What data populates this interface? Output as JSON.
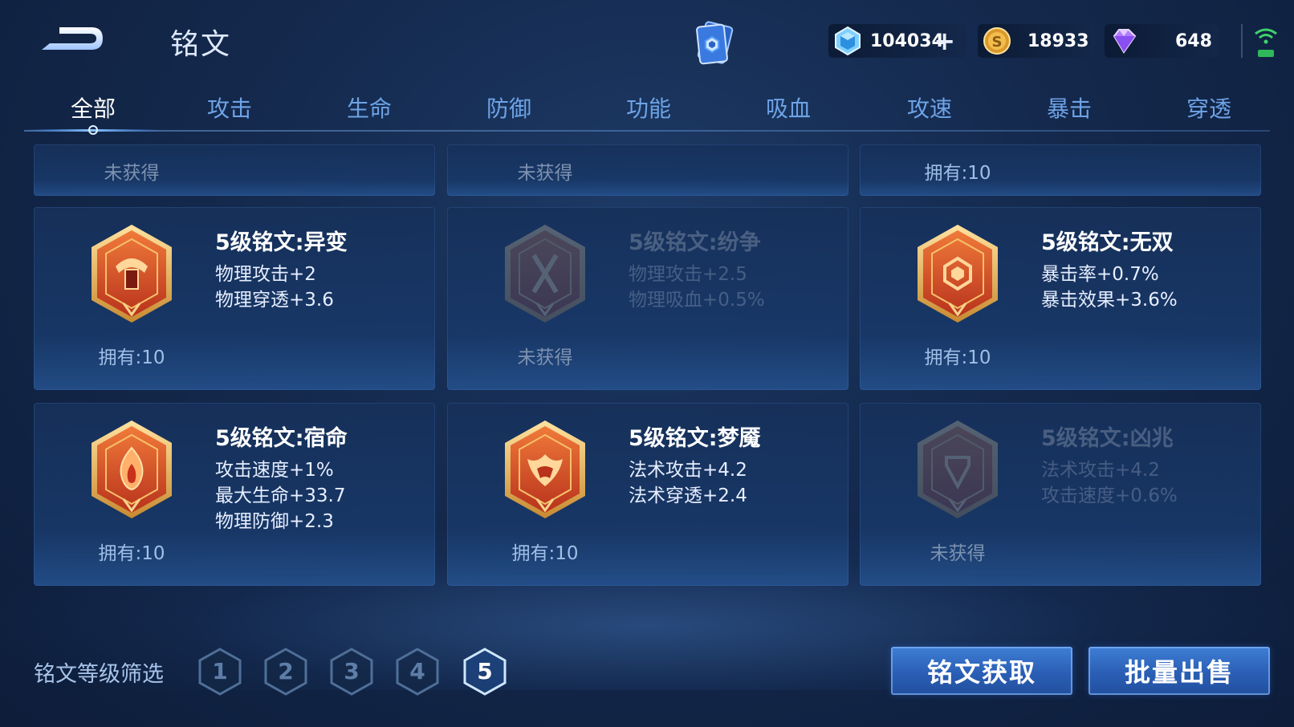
{
  "header": {
    "title": "铭文",
    "currencies": {
      "gem": "104034",
      "gold": "18933",
      "diamond": "648"
    }
  },
  "tabs": [
    "全部",
    "攻击",
    "生命",
    "防御",
    "功能",
    "吸血",
    "攻速",
    "暴击",
    "穿透"
  ],
  "active_tab": "全部",
  "top_row": [
    {
      "own": "未获得",
      "owned": false
    },
    {
      "own": "未获得",
      "owned": false
    },
    {
      "own": "拥有:10",
      "owned": true
    }
  ],
  "runes": [
    {
      "name": "5级铭文:异变",
      "stats": [
        "物理攻击+2",
        "物理穿透+3.6"
      ],
      "own": "拥有:10",
      "owned": true,
      "icon": "rune-yibian-icon"
    },
    {
      "name": "5级铭文:纷争",
      "stats": [
        "物理攻击+2.5",
        "物理吸血+0.5%"
      ],
      "own": "未获得",
      "owned": false,
      "icon": "rune-fenzheng-icon"
    },
    {
      "name": "5级铭文:无双",
      "stats": [
        "暴击率+0.7%",
        "暴击效果+3.6%"
      ],
      "own": "拥有:10",
      "owned": true,
      "icon": "rune-wushuang-icon"
    },
    {
      "name": "5级铭文:宿命",
      "stats": [
        "攻击速度+1%",
        "最大生命+33.7",
        "物理防御+2.3"
      ],
      "own": "拥有:10",
      "owned": true,
      "icon": "rune-suming-icon"
    },
    {
      "name": "5级铭文:梦魇",
      "stats": [
        "法术攻击+4.2",
        "法术穿透+2.4"
      ],
      "own": "拥有:10",
      "owned": true,
      "icon": "rune-mengyan-icon"
    },
    {
      "name": "5级铭文:凶兆",
      "stats": [
        "法术攻击+4.2",
        "攻击速度+0.6%"
      ],
      "own": "未获得",
      "owned": false,
      "icon": "rune-xiongzhao-icon"
    }
  ],
  "filter": {
    "label": "铭文等级筛选",
    "levels": [
      "1",
      "2",
      "3",
      "4",
      "5"
    ],
    "selected": "5"
  },
  "buttons": {
    "obtain": "铭文获取",
    "sell": "批量出售"
  },
  "colors": {
    "accent": "#3f7ed6",
    "tab_inactive": "#6ea3e6",
    "emblem_orange": "#d8572a",
    "emblem_gold": "#f0b85a"
  }
}
